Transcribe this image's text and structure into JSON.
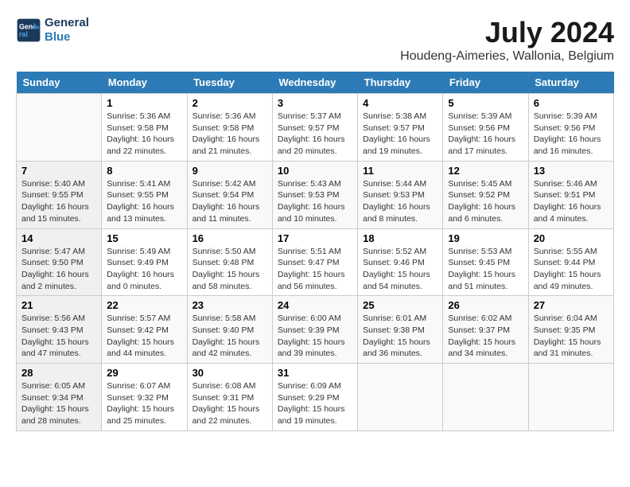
{
  "header": {
    "logo_line1": "General",
    "logo_line2": "Blue",
    "title": "July 2024",
    "subtitle": "Houdeng-Aimeries, Wallonia, Belgium"
  },
  "days_of_week": [
    "Sunday",
    "Monday",
    "Tuesday",
    "Wednesday",
    "Thursday",
    "Friday",
    "Saturday"
  ],
  "weeks": [
    [
      {
        "day": "",
        "info": ""
      },
      {
        "day": "1",
        "info": "Sunrise: 5:36 AM\nSunset: 9:58 PM\nDaylight: 16 hours\nand 22 minutes."
      },
      {
        "day": "2",
        "info": "Sunrise: 5:36 AM\nSunset: 9:58 PM\nDaylight: 16 hours\nand 21 minutes."
      },
      {
        "day": "3",
        "info": "Sunrise: 5:37 AM\nSunset: 9:57 PM\nDaylight: 16 hours\nand 20 minutes."
      },
      {
        "day": "4",
        "info": "Sunrise: 5:38 AM\nSunset: 9:57 PM\nDaylight: 16 hours\nand 19 minutes."
      },
      {
        "day": "5",
        "info": "Sunrise: 5:39 AM\nSunset: 9:56 PM\nDaylight: 16 hours\nand 17 minutes."
      },
      {
        "day": "6",
        "info": "Sunrise: 5:39 AM\nSunset: 9:56 PM\nDaylight: 16 hours\nand 16 minutes."
      }
    ],
    [
      {
        "day": "7",
        "info": "Sunrise: 5:40 AM\nSunset: 9:55 PM\nDaylight: 16 hours\nand 15 minutes."
      },
      {
        "day": "8",
        "info": "Sunrise: 5:41 AM\nSunset: 9:55 PM\nDaylight: 16 hours\nand 13 minutes."
      },
      {
        "day": "9",
        "info": "Sunrise: 5:42 AM\nSunset: 9:54 PM\nDaylight: 16 hours\nand 11 minutes."
      },
      {
        "day": "10",
        "info": "Sunrise: 5:43 AM\nSunset: 9:53 PM\nDaylight: 16 hours\nand 10 minutes."
      },
      {
        "day": "11",
        "info": "Sunrise: 5:44 AM\nSunset: 9:53 PM\nDaylight: 16 hours\nand 8 minutes."
      },
      {
        "day": "12",
        "info": "Sunrise: 5:45 AM\nSunset: 9:52 PM\nDaylight: 16 hours\nand 6 minutes."
      },
      {
        "day": "13",
        "info": "Sunrise: 5:46 AM\nSunset: 9:51 PM\nDaylight: 16 hours\nand 4 minutes."
      }
    ],
    [
      {
        "day": "14",
        "info": "Sunrise: 5:47 AM\nSunset: 9:50 PM\nDaylight: 16 hours\nand 2 minutes."
      },
      {
        "day": "15",
        "info": "Sunrise: 5:49 AM\nSunset: 9:49 PM\nDaylight: 16 hours\nand 0 minutes."
      },
      {
        "day": "16",
        "info": "Sunrise: 5:50 AM\nSunset: 9:48 PM\nDaylight: 15 hours\nand 58 minutes."
      },
      {
        "day": "17",
        "info": "Sunrise: 5:51 AM\nSunset: 9:47 PM\nDaylight: 15 hours\nand 56 minutes."
      },
      {
        "day": "18",
        "info": "Sunrise: 5:52 AM\nSunset: 9:46 PM\nDaylight: 15 hours\nand 54 minutes."
      },
      {
        "day": "19",
        "info": "Sunrise: 5:53 AM\nSunset: 9:45 PM\nDaylight: 15 hours\nand 51 minutes."
      },
      {
        "day": "20",
        "info": "Sunrise: 5:55 AM\nSunset: 9:44 PM\nDaylight: 15 hours\nand 49 minutes."
      }
    ],
    [
      {
        "day": "21",
        "info": "Sunrise: 5:56 AM\nSunset: 9:43 PM\nDaylight: 15 hours\nand 47 minutes."
      },
      {
        "day": "22",
        "info": "Sunrise: 5:57 AM\nSunset: 9:42 PM\nDaylight: 15 hours\nand 44 minutes."
      },
      {
        "day": "23",
        "info": "Sunrise: 5:58 AM\nSunset: 9:40 PM\nDaylight: 15 hours\nand 42 minutes."
      },
      {
        "day": "24",
        "info": "Sunrise: 6:00 AM\nSunset: 9:39 PM\nDaylight: 15 hours\nand 39 minutes."
      },
      {
        "day": "25",
        "info": "Sunrise: 6:01 AM\nSunset: 9:38 PM\nDaylight: 15 hours\nand 36 minutes."
      },
      {
        "day": "26",
        "info": "Sunrise: 6:02 AM\nSunset: 9:37 PM\nDaylight: 15 hours\nand 34 minutes."
      },
      {
        "day": "27",
        "info": "Sunrise: 6:04 AM\nSunset: 9:35 PM\nDaylight: 15 hours\nand 31 minutes."
      }
    ],
    [
      {
        "day": "28",
        "info": "Sunrise: 6:05 AM\nSunset: 9:34 PM\nDaylight: 15 hours\nand 28 minutes."
      },
      {
        "day": "29",
        "info": "Sunrise: 6:07 AM\nSunset: 9:32 PM\nDaylight: 15 hours\nand 25 minutes."
      },
      {
        "day": "30",
        "info": "Sunrise: 6:08 AM\nSunset: 9:31 PM\nDaylight: 15 hours\nand 22 minutes."
      },
      {
        "day": "31",
        "info": "Sunrise: 6:09 AM\nSunset: 9:29 PM\nDaylight: 15 hours\nand 19 minutes."
      },
      {
        "day": "",
        "info": ""
      },
      {
        "day": "",
        "info": ""
      },
      {
        "day": "",
        "info": ""
      }
    ]
  ]
}
